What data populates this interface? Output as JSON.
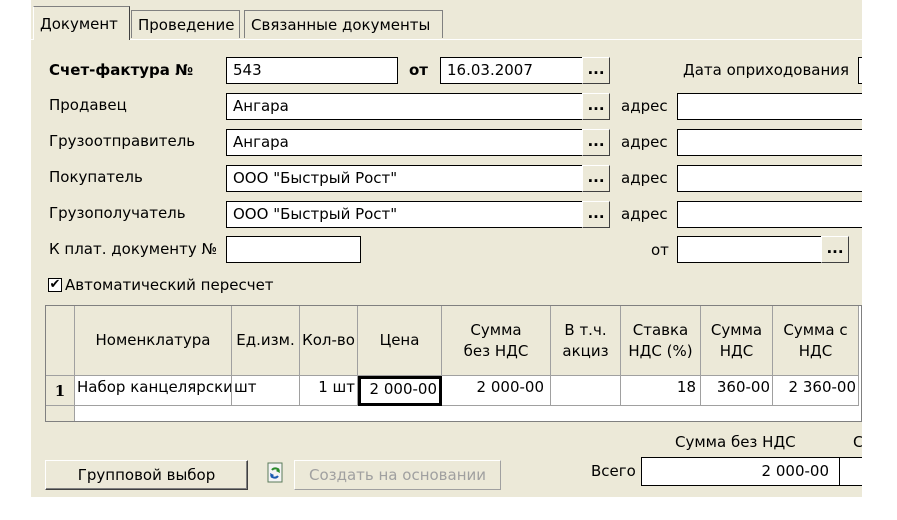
{
  "tabs": [
    "Документ",
    "Проведение",
    "Связанные документы"
  ],
  "invoice": {
    "label": "Счет-фактура №",
    "number": "543",
    "from_label": "от",
    "date": "16.03.2007",
    "receipt_date_label": "Дата оприходования"
  },
  "parties": [
    {
      "label": "Продавец",
      "value": "Ангара",
      "address_label": "адрес"
    },
    {
      "label": "Грузоотправитель",
      "value": "Ангара",
      "address_label": "адрес"
    },
    {
      "label": "Покупатель",
      "value": "ООО \"Быстрый Рост\"",
      "address_label": "адрес"
    },
    {
      "label": "Грузополучатель",
      "value": "ООО \"Быстрый Рост\"",
      "address_label": "адрес"
    }
  ],
  "payment_doc": {
    "label": "К плат. документу №",
    "value": "",
    "from_label": "от",
    "date": ""
  },
  "auto_recalc": {
    "label": "Автоматический пересчет",
    "checked": true
  },
  "dots_label": "...",
  "table": {
    "headers": [
      "Номенклатура",
      "Ед.изм.",
      "Кол-во",
      "Цена",
      "Сумма без НДС",
      "В т.ч. акциз",
      "Ставка НДС (%)",
      "Сумма НДС",
      "Сумма с НДС"
    ],
    "rows": [
      {
        "num": "1",
        "item": "Набор канцелярских",
        "unit": "шт",
        "qty": "1 шт",
        "price": "2 000-00",
        "sum_no_vat": "2 000-00",
        "excise": "",
        "vat_rate": "18",
        "vat_sum": "360-00",
        "sum_with_vat": "2 360-00"
      }
    ]
  },
  "totals": {
    "sum_no_vat_label": "Сумма без НДС",
    "next_label_fragment": "С",
    "total_label": "Всего",
    "total_value": "2 000-00"
  },
  "buttons": {
    "group_select": "Групповой выбор",
    "create_based": "Создать на основании"
  }
}
